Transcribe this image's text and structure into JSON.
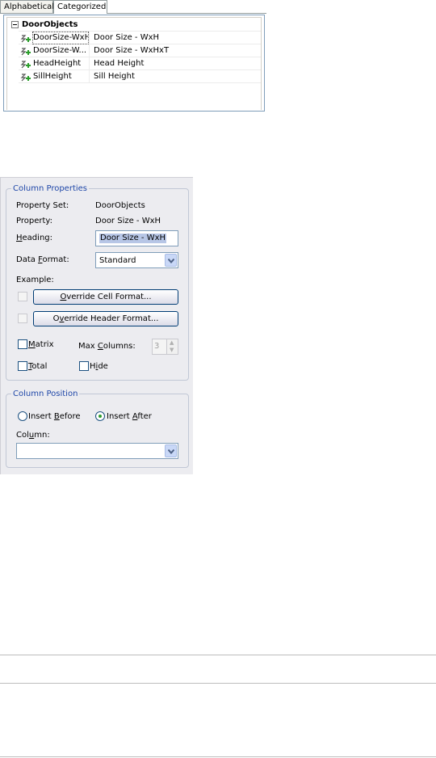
{
  "tabs": [
    {
      "label": "Alphabetical",
      "active": false
    },
    {
      "label": "Categorized",
      "active": true
    }
  ],
  "tree": {
    "group": "DoorObjects",
    "rows": [
      {
        "name": "DoorSize-WxH",
        "value": "Door Size - WxH",
        "icon": "property-add-icon",
        "selected": true
      },
      {
        "name": "DoorSize-W...",
        "value": "Door Size - WxHxT",
        "icon": "property-add-icon",
        "selected": false
      },
      {
        "name": "HeadHeight",
        "value": "Head Height",
        "icon": "property-add-icon",
        "selected": false
      },
      {
        "name": "SillHeight",
        "value": "Sill Height",
        "icon": "property-add-icon",
        "selected": false
      }
    ]
  },
  "column_properties": {
    "title": "Column Properties",
    "property_set_label": "Property Set:",
    "property_set_value": "DoorObjects",
    "property_label": "Property:",
    "property_value": "Door Size - WxH",
    "heading_label_pre": "",
    "heading_label_u": "H",
    "heading_label_post": "eading:",
    "heading_value": "Door Size - WxH",
    "data_format_pre": "Data ",
    "data_format_u": "F",
    "data_format_post": "ormat:",
    "data_format_value": "Standard",
    "example_label": "Example:",
    "override_cell_u": "O",
    "override_cell_rest": "verride Cell Format...",
    "override_header_pre": "O",
    "override_header_u": "v",
    "override_header_rest": "erride Header Format...",
    "matrix_u": "M",
    "matrix_rest": "atrix",
    "max_columns_pre": "Max ",
    "max_columns_u": "C",
    "max_columns_post": "olumns:",
    "max_columns_value": "3",
    "total_u": "T",
    "total_rest": "otal",
    "hide_pre": "H",
    "hide_u": "i",
    "hide_rest": "de"
  },
  "column_position": {
    "title": "Column Position",
    "insert_before_pre": "Insert ",
    "insert_before_u": "B",
    "insert_before_post": "efore",
    "insert_after_pre": "Insert ",
    "insert_after_u": "A",
    "insert_after_post": "fter",
    "selected": "after",
    "column_pre": "Col",
    "column_u": "u",
    "column_post": "mn:",
    "column_value": ""
  },
  "colors": {
    "group_title": "#1f47a8",
    "panel_bg": "#ececf0",
    "border": "#7f9db9"
  }
}
